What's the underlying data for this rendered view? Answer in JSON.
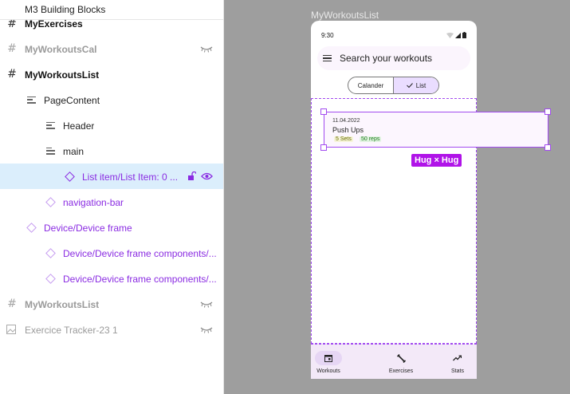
{
  "layers": {
    "page_name": "M3 Building Blocks",
    "items": [
      {
        "label": "MyExercises",
        "icon": "frame-icon"
      },
      {
        "label": "MyWorkoutsCal",
        "icon": "frame-icon"
      },
      {
        "label": "MyWorkoutsList",
        "icon": "frame-icon"
      },
      {
        "label": "PageContent",
        "icon": "auto-layout-icon"
      },
      {
        "label": "Header",
        "icon": "auto-layout-icon"
      },
      {
        "label": "main",
        "icon": "auto-layout-icon"
      },
      {
        "label": "List item/List Item: 0 ...",
        "icon": "instance-icon"
      },
      {
        "label": "navigation-bar",
        "icon": "instance-icon"
      },
      {
        "label": "Device/Device frame",
        "icon": "instance-icon"
      },
      {
        "label": "Device/Device frame components/...",
        "icon": "instance-icon"
      },
      {
        "label": "Device/Device frame components/...",
        "icon": "instance-icon"
      },
      {
        "label": "MyWorkoutsList",
        "icon": "frame-icon"
      },
      {
        "label": "Exercice Tracker-23 1",
        "icon": "image-icon"
      }
    ]
  },
  "canvas": {
    "frame_title": "MyWorkoutsList",
    "status_time": "9:30",
    "search_placeholder": "Search your workouts",
    "segments": {
      "left": "Calander",
      "right": "List"
    },
    "list_item": {
      "date": "11.04.2022",
      "title": "Push Ups",
      "sets": "5 Sets",
      "reps": "50 reps"
    },
    "hug_badge": "Hug × Hug",
    "nav": [
      {
        "label": "Workouts",
        "icon": "calendar-icon"
      },
      {
        "label": "Exercises",
        "icon": "fitness-icon"
      },
      {
        "label": "Stats",
        "icon": "trending-up-icon"
      }
    ]
  },
  "colors": {
    "accent": "#a24bf0",
    "selection": "#dbeefc",
    "canvas": "#9e9e9e"
  }
}
